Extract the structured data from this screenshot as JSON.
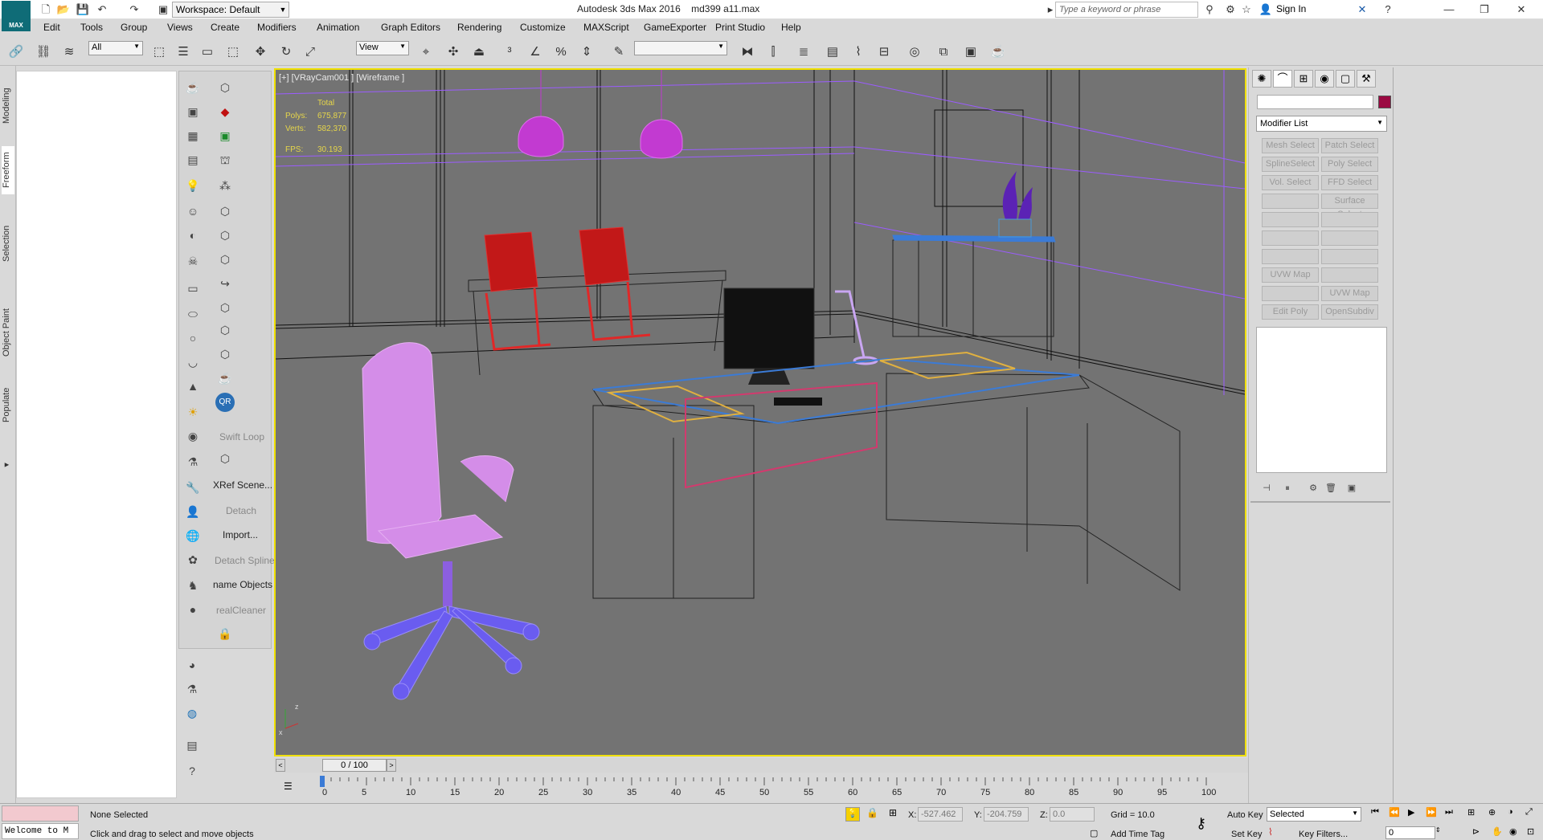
{
  "app": {
    "logo_text": "MAX",
    "window_title": "Autodesk 3ds Max 2016",
    "file_name": "md399 a11.max"
  },
  "workspace": {
    "label": "Workspace: Default"
  },
  "search": {
    "placeholder": "Type a keyword or phrase"
  },
  "account": {
    "sign_in": "Sign In"
  },
  "menu": {
    "items": [
      "Edit",
      "Tools",
      "Group",
      "Views",
      "Create",
      "Modifiers",
      "Animation",
      "Graph Editors",
      "Rendering",
      "Customize",
      "MAXScript",
      "GameExporter",
      "Print Studio",
      "Help"
    ]
  },
  "toolbar": {
    "selection_filter": "All",
    "ref_coord": "View",
    "named_sel": ""
  },
  "left_tabs": [
    "Modeling",
    "Freeform",
    "Selection",
    "Object Paint",
    "Populate"
  ],
  "icon_panel": {
    "swift_loop": "Swift Loop",
    "xref_scene": "XRef Scene...",
    "detach": "Detach",
    "import": "Import...",
    "detach_spline": "Detach Spline",
    "rename_objects": "name Objects",
    "realcleaner": "realCleaner"
  },
  "viewport": {
    "label": "[+] [VRayCam001 ] [Wireframe ]",
    "stats": {
      "total_label": "Total",
      "polys_label": "Polys:",
      "polys": "675,877",
      "verts_label": "Verts:",
      "verts": "582,370",
      "fps_label": "FPS:",
      "fps": "30.193"
    }
  },
  "command_panel": {
    "modifier_list": "Modifier List",
    "buttons": [
      "Mesh Select",
      "Patch Select",
      "SplineSelect",
      "Poly Select",
      "Vol. Select",
      "FFD Select",
      "",
      "Surface Select",
      "",
      "",
      "",
      "",
      "",
      "",
      "UVW Map",
      "",
      "",
      "UVW Map",
      "Edit Poly",
      "OpenSubdiv"
    ],
    "color": "#9b0a42"
  },
  "time_slider": {
    "text": "0 / 100"
  },
  "timeline": {
    "ticks": [
      "0",
      "5",
      "10",
      "15",
      "20",
      "25",
      "30",
      "35",
      "40",
      "45",
      "50",
      "55",
      "60",
      "65",
      "70",
      "75",
      "80",
      "85",
      "90",
      "95",
      "100"
    ]
  },
  "status": {
    "listener": "Welcome to M",
    "selection": "None Selected",
    "prompt": "Click and drag to select and move objects",
    "x_label": "X:",
    "x": "-527.462",
    "y_label": "Y:",
    "y": "-204.759",
    "z_label": "Z:",
    "z": "0.0",
    "grid": "Grid = 10.0",
    "add_time_tag": "Add Time Tag",
    "auto_key": "Auto Key",
    "set_key": "Set Key",
    "key_mode": "Selected",
    "key_filters": "Key Filters...",
    "frame": "0"
  }
}
